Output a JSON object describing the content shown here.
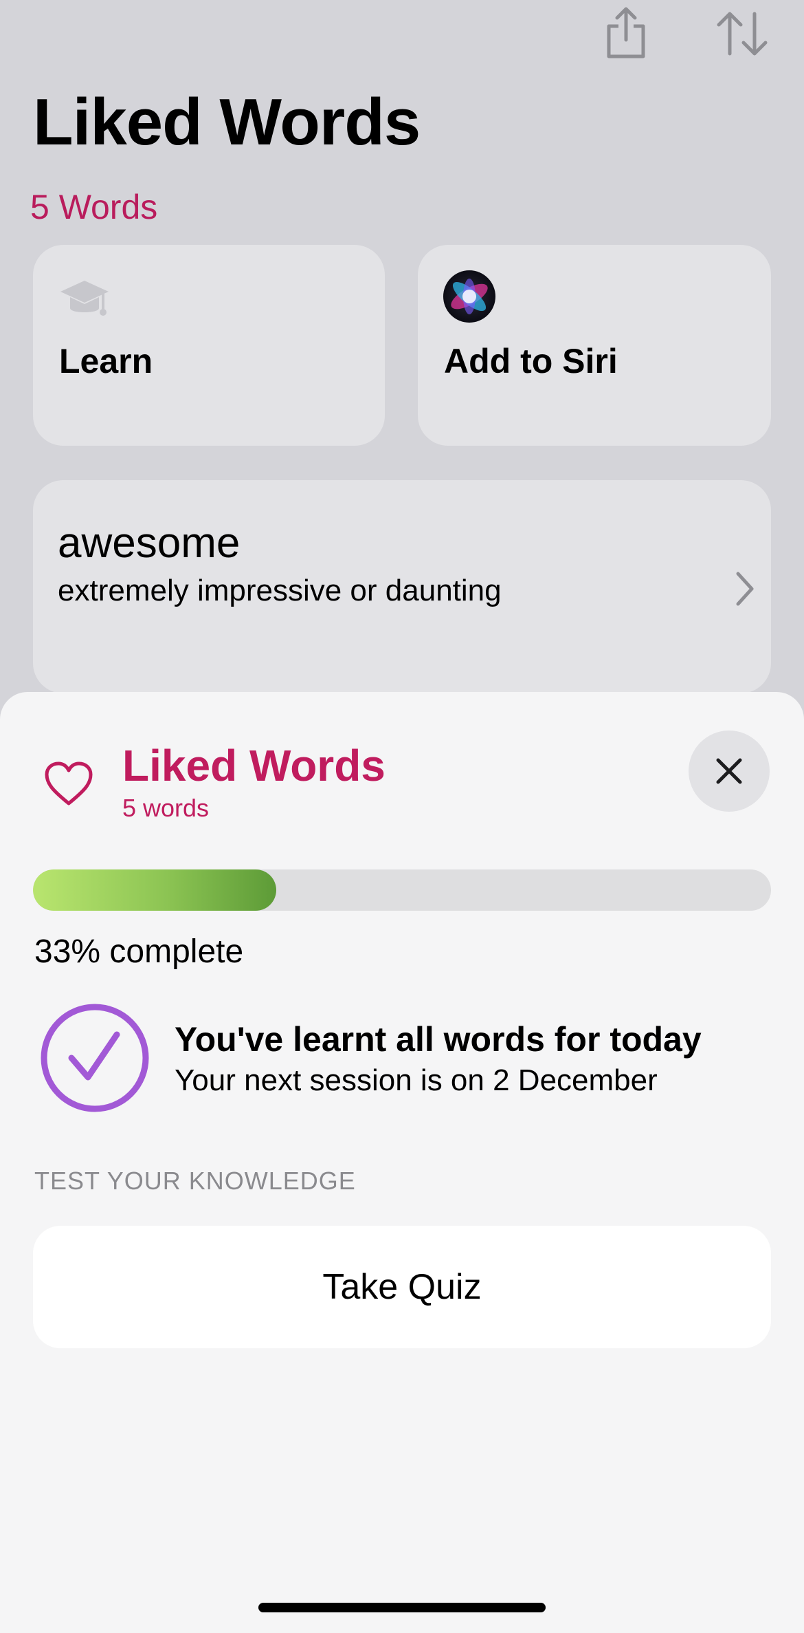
{
  "header": {
    "title": "Liked Words",
    "count": "5 Words",
    "share_icon": "share-icon",
    "sort_icon": "sort-icon"
  },
  "tiles": [
    {
      "label": "Learn",
      "icon": "graduation-cap-icon"
    },
    {
      "label": "Add to Siri",
      "icon": "siri-icon"
    }
  ],
  "word_card": {
    "term": "awesome",
    "definition": "extremely impressive or daunting"
  },
  "sheet": {
    "title": "Liked Words",
    "subtitle": "5 words",
    "progress_fraction": 0.33,
    "progress_text": "33% complete",
    "status_title": "You've learnt all words for today",
    "status_subtitle": "Your next session is on 2 December",
    "section_label": "TEST YOUR KNOWLEDGE",
    "quiz_button": "Take Quiz"
  },
  "colors": {
    "accent": "#c01c5e",
    "check": "#a259d6",
    "progress_start": "#b9e56f",
    "progress_end": "#5d9b37"
  }
}
